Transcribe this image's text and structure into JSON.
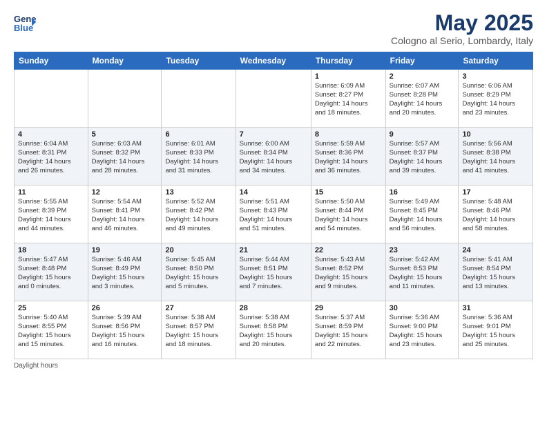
{
  "logo": {
    "line1": "General",
    "line2": "Blue",
    "icon": "▶"
  },
  "title": "May 2025",
  "subtitle": "Cologno al Serio, Lombardy, Italy",
  "days_of_week": [
    "Sunday",
    "Monday",
    "Tuesday",
    "Wednesday",
    "Thursday",
    "Friday",
    "Saturday"
  ],
  "footer": "Daylight hours",
  "weeks": [
    [
      {
        "num": "",
        "info": ""
      },
      {
        "num": "",
        "info": ""
      },
      {
        "num": "",
        "info": ""
      },
      {
        "num": "",
        "info": ""
      },
      {
        "num": "1",
        "info": "Sunrise: 6:09 AM\nSunset: 8:27 PM\nDaylight: 14 hours\nand 18 minutes."
      },
      {
        "num": "2",
        "info": "Sunrise: 6:07 AM\nSunset: 8:28 PM\nDaylight: 14 hours\nand 20 minutes."
      },
      {
        "num": "3",
        "info": "Sunrise: 6:06 AM\nSunset: 8:29 PM\nDaylight: 14 hours\nand 23 minutes."
      }
    ],
    [
      {
        "num": "4",
        "info": "Sunrise: 6:04 AM\nSunset: 8:31 PM\nDaylight: 14 hours\nand 26 minutes."
      },
      {
        "num": "5",
        "info": "Sunrise: 6:03 AM\nSunset: 8:32 PM\nDaylight: 14 hours\nand 28 minutes."
      },
      {
        "num": "6",
        "info": "Sunrise: 6:01 AM\nSunset: 8:33 PM\nDaylight: 14 hours\nand 31 minutes."
      },
      {
        "num": "7",
        "info": "Sunrise: 6:00 AM\nSunset: 8:34 PM\nDaylight: 14 hours\nand 34 minutes."
      },
      {
        "num": "8",
        "info": "Sunrise: 5:59 AM\nSunset: 8:36 PM\nDaylight: 14 hours\nand 36 minutes."
      },
      {
        "num": "9",
        "info": "Sunrise: 5:57 AM\nSunset: 8:37 PM\nDaylight: 14 hours\nand 39 minutes."
      },
      {
        "num": "10",
        "info": "Sunrise: 5:56 AM\nSunset: 8:38 PM\nDaylight: 14 hours\nand 41 minutes."
      }
    ],
    [
      {
        "num": "11",
        "info": "Sunrise: 5:55 AM\nSunset: 8:39 PM\nDaylight: 14 hours\nand 44 minutes."
      },
      {
        "num": "12",
        "info": "Sunrise: 5:54 AM\nSunset: 8:41 PM\nDaylight: 14 hours\nand 46 minutes."
      },
      {
        "num": "13",
        "info": "Sunrise: 5:52 AM\nSunset: 8:42 PM\nDaylight: 14 hours\nand 49 minutes."
      },
      {
        "num": "14",
        "info": "Sunrise: 5:51 AM\nSunset: 8:43 PM\nDaylight: 14 hours\nand 51 minutes."
      },
      {
        "num": "15",
        "info": "Sunrise: 5:50 AM\nSunset: 8:44 PM\nDaylight: 14 hours\nand 54 minutes."
      },
      {
        "num": "16",
        "info": "Sunrise: 5:49 AM\nSunset: 8:45 PM\nDaylight: 14 hours\nand 56 minutes."
      },
      {
        "num": "17",
        "info": "Sunrise: 5:48 AM\nSunset: 8:46 PM\nDaylight: 14 hours\nand 58 minutes."
      }
    ],
    [
      {
        "num": "18",
        "info": "Sunrise: 5:47 AM\nSunset: 8:48 PM\nDaylight: 15 hours\nand 0 minutes."
      },
      {
        "num": "19",
        "info": "Sunrise: 5:46 AM\nSunset: 8:49 PM\nDaylight: 15 hours\nand 3 minutes."
      },
      {
        "num": "20",
        "info": "Sunrise: 5:45 AM\nSunset: 8:50 PM\nDaylight: 15 hours\nand 5 minutes."
      },
      {
        "num": "21",
        "info": "Sunrise: 5:44 AM\nSunset: 8:51 PM\nDaylight: 15 hours\nand 7 minutes."
      },
      {
        "num": "22",
        "info": "Sunrise: 5:43 AM\nSunset: 8:52 PM\nDaylight: 15 hours\nand 9 minutes."
      },
      {
        "num": "23",
        "info": "Sunrise: 5:42 AM\nSunset: 8:53 PM\nDaylight: 15 hours\nand 11 minutes."
      },
      {
        "num": "24",
        "info": "Sunrise: 5:41 AM\nSunset: 8:54 PM\nDaylight: 15 hours\nand 13 minutes."
      }
    ],
    [
      {
        "num": "25",
        "info": "Sunrise: 5:40 AM\nSunset: 8:55 PM\nDaylight: 15 hours\nand 15 minutes."
      },
      {
        "num": "26",
        "info": "Sunrise: 5:39 AM\nSunset: 8:56 PM\nDaylight: 15 hours\nand 16 minutes."
      },
      {
        "num": "27",
        "info": "Sunrise: 5:38 AM\nSunset: 8:57 PM\nDaylight: 15 hours\nand 18 minutes."
      },
      {
        "num": "28",
        "info": "Sunrise: 5:38 AM\nSunset: 8:58 PM\nDaylight: 15 hours\nand 20 minutes."
      },
      {
        "num": "29",
        "info": "Sunrise: 5:37 AM\nSunset: 8:59 PM\nDaylight: 15 hours\nand 22 minutes."
      },
      {
        "num": "30",
        "info": "Sunrise: 5:36 AM\nSunset: 9:00 PM\nDaylight: 15 hours\nand 23 minutes."
      },
      {
        "num": "31",
        "info": "Sunrise: 5:36 AM\nSunset: 9:01 PM\nDaylight: 15 hours\nand 25 minutes."
      }
    ]
  ]
}
